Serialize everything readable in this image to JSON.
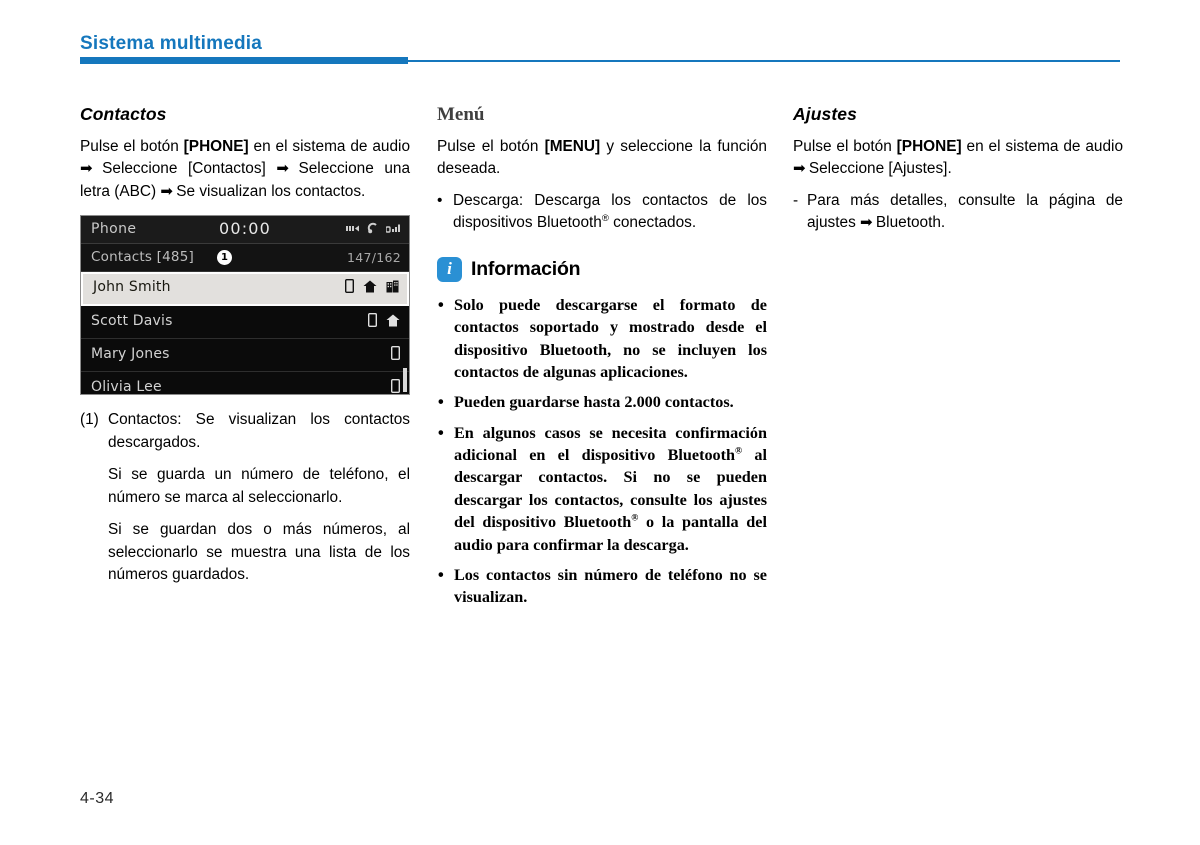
{
  "header": {
    "title": "Sistema multimedia",
    "accent_color": "#1577bd"
  },
  "page_number": "4-34",
  "columns": {
    "left": {
      "heading": "Contactos",
      "intro_part1": "Pulse el botón ",
      "intro_bold1": "[PHONE]",
      "intro_part2": " en el sistema de audio ",
      "arrow": "➡",
      "intro_part3": " Seleccione [Contactos] ",
      "intro_part4": " Seleccione una letra (ABC) ",
      "intro_part5": " Se visualizan los contactos.",
      "note_number": "(1)",
      "note_text": "Contactos: Se visualizan los contactos descargados.",
      "note_cont1": "Si se guarda un número de teléfono, el número se marca al seleccionarlo.",
      "note_cont2": "Si se guardan dos o más números, al seleccionarlo se muestra una lista de los números guardados."
    },
    "middle": {
      "heading": "Menú",
      "intro_part1": "Pulse el botón ",
      "intro_bold1": "[MENU]",
      "intro_part2": " y seleccione la función deseada.",
      "bullet_marker": "•",
      "bullet1_pre": "Descarga: Descarga los contactos de los dispositivos Bluetooth",
      "bullet1_reg": "®",
      "bullet1_post": " conectados.",
      "info": {
        "icon_letter": "i",
        "icon_color": "#2a90d4",
        "title": "Información",
        "bullets": [
          {
            "pre": "Solo puede descargarse el formato de contactos soportado y mostrado desde el dispositivo Bluetooth, no se incluyen los contactos de algunas aplicaciones.",
            "reg": "",
            "post": ""
          },
          {
            "pre": "Pueden guardarse hasta 2.000 contactos.",
            "reg": "",
            "post": ""
          },
          {
            "pre": "En algunos casos se necesita confirmación adicional en el dispositivo Bluetooth",
            "reg": "®",
            "post": " al descargar contactos. Si no se pueden descargar los contactos, consulte los ajustes del dispositivo Bluetooth",
            "reg2": "®",
            "post2": " o la pantalla del audio para confirmar la descarga."
          },
          {
            "pre": "Los contactos sin número de teléfono no se visualizan.",
            "reg": "",
            "post": ""
          }
        ]
      }
    },
    "right": {
      "heading": "Ajustes",
      "intro_part1": "Pulse el botón ",
      "intro_bold1": "[PHONE]",
      "intro_part2": " en el sistema de audio ",
      "intro_part3": " Seleccione [Ajustes].",
      "dash_marker": "-",
      "dash_text_pre": "Para más detalles, consulte la página de ajustes ",
      "dash_text_post": " Bluetooth."
    }
  },
  "screen": {
    "status": {
      "title": "Phone",
      "clock": "00:00",
      "icons": [
        "signal-bars-icon",
        "bluetooth-headset-icon",
        "cellular-signal-icon"
      ]
    },
    "subbar": {
      "label": "Contacts [485]",
      "badge": "1",
      "count": "147/162"
    },
    "rows": [
      {
        "name": "John Smith",
        "selected": true,
        "icons": [
          "mobile-phone-icon",
          "home-icon",
          "office-icon"
        ]
      },
      {
        "name": "Scott Davis",
        "selected": false,
        "icons": [
          "mobile-phone-icon",
          "home-icon"
        ]
      },
      {
        "name": "Mary Jones",
        "selected": false,
        "icons": [
          "mobile-phone-icon"
        ]
      },
      {
        "name": "Olivia Lee",
        "selected": false,
        "icons": [
          "mobile-phone-icon"
        ]
      }
    ]
  }
}
